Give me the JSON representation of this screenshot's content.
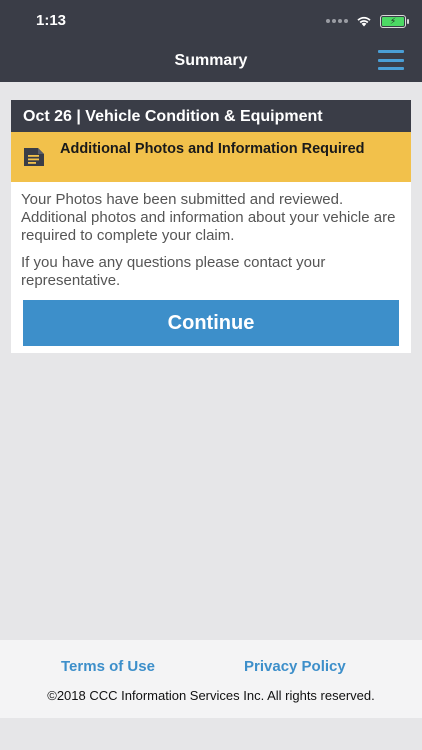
{
  "status_bar": {
    "time": "1:13",
    "battery_icon": "battery-charging-icon",
    "wifi_icon": "wifi-icon"
  },
  "nav": {
    "title": "Summary",
    "menu_icon": "hamburger-menu-icon"
  },
  "card": {
    "header": "Oct 26 | Vehicle Condition & Equipment",
    "alert": {
      "icon": "document-icon",
      "title": "Additional Photos and Information Required",
      "color": "#f2c14b"
    },
    "message_1": "Your Photos have been submitted and reviewed. Additional photos and information about your vehicle are required to complete your claim.",
    "message_2": "If you have any questions please contact your representative.",
    "continue_label": "Continue"
  },
  "footer": {
    "terms_label": "Terms of Use",
    "privacy_label": "Privacy Policy",
    "copyright": "©2018 CCC Information Services Inc. All rights reserved."
  },
  "colors": {
    "header_dark": "#3a3d47",
    "accent_blue": "#3d8fca",
    "background": "#e6e6e8"
  }
}
